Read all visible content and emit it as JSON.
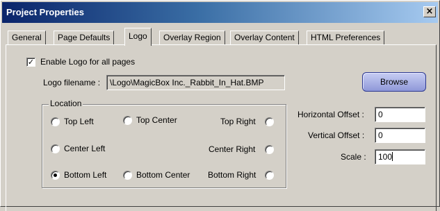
{
  "window": {
    "title": "Project Properties",
    "close_glyph": "×"
  },
  "tabs": [
    {
      "label": "General"
    },
    {
      "label": "Page Defaults"
    },
    {
      "label": "Logo",
      "active": true
    },
    {
      "label": "Overlay Region"
    },
    {
      "label": "Overlay Content"
    },
    {
      "label": "HTML Preferences"
    }
  ],
  "logo": {
    "enable_label": "Enable Logo for all pages",
    "enable_checked": true,
    "filename_label": "Logo filename :",
    "filename_value": "\\Logo\\MagicBox Inc._Rabbit_In_Hat.BMP",
    "browse_label": "Browse"
  },
  "location": {
    "legend": "Location",
    "options": [
      {
        "label": "Top Left",
        "selected": false
      },
      {
        "label": "Top Center",
        "selected": false
      },
      {
        "label": "Top Right",
        "selected": false
      },
      {
        "label": "Center Left",
        "selected": false
      },
      {
        "label": "Center Right",
        "selected": false
      },
      {
        "label": "Bottom Left",
        "selected": true
      },
      {
        "label": "Bottom Center",
        "selected": false
      },
      {
        "label": "Bottom Right",
        "selected": false
      }
    ]
  },
  "offsets": {
    "horizontal_label": "Horizontal Offset :",
    "horizontal_value": "0",
    "vertical_label": "Vertical Offset :",
    "vertical_value": "0",
    "scale_label": "Scale :",
    "scale_value": "100"
  },
  "colors": {
    "titlebar_start": "#0a246a",
    "titlebar_end": "#a6caf0",
    "browse_button": "#8f98d8"
  },
  "icons": {
    "close": "close-icon",
    "check": "checkmark-icon"
  }
}
